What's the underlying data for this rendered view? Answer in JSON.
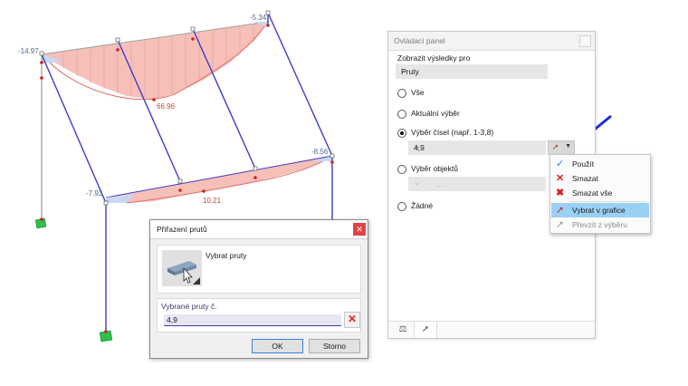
{
  "colors": {
    "member": "#3c3cc8",
    "diagram_fill": "#f6c0b8",
    "diagram_line": "#e26b6b",
    "negative": "#4a6a95",
    "accent": "#2a7bd8"
  },
  "structure_labels": {
    "v1": "-14.97",
    "v2": "66.96",
    "v3": "-5.34",
    "v4": "-8.56",
    "v5": "-7.93",
    "v6": "10.21"
  },
  "panel": {
    "title": "Ovládací panel",
    "show_results_label": "Zobrazit výsledky pro",
    "show_results_value": "Pruty",
    "options": [
      {
        "label": "Vše",
        "selected": false
      },
      {
        "label": "Aktuální výběr",
        "selected": false
      },
      {
        "label": "Výběr čísel (např. 1-3,8)",
        "selected": true
      },
      {
        "label": "Výběr objektů",
        "selected": false
      },
      {
        "label": "Žádné",
        "selected": false
      }
    ],
    "numbers_value": "4,9",
    "objects_value": "..."
  },
  "menu": {
    "items": [
      {
        "label": "Použít",
        "icon": "check-icon"
      },
      {
        "label": "Smazat",
        "icon": "cross-icon"
      },
      {
        "label": "Smazat vše",
        "icon": "cross-all-icon"
      },
      {
        "label": "Vybrat v grafice",
        "icon": "cursor-pick-icon",
        "highlighted": true
      },
      {
        "label": "Převzít z výběru",
        "icon": "cursor-take-icon",
        "disabled": true
      }
    ]
  },
  "dialog": {
    "title": "Přiřazení prutů",
    "pick_label": "Vybrat pruty",
    "selected_label": "Vybrané pruty č.",
    "selected_value": "4,9",
    "ok_label": "OK",
    "cancel_label": "Storno"
  }
}
